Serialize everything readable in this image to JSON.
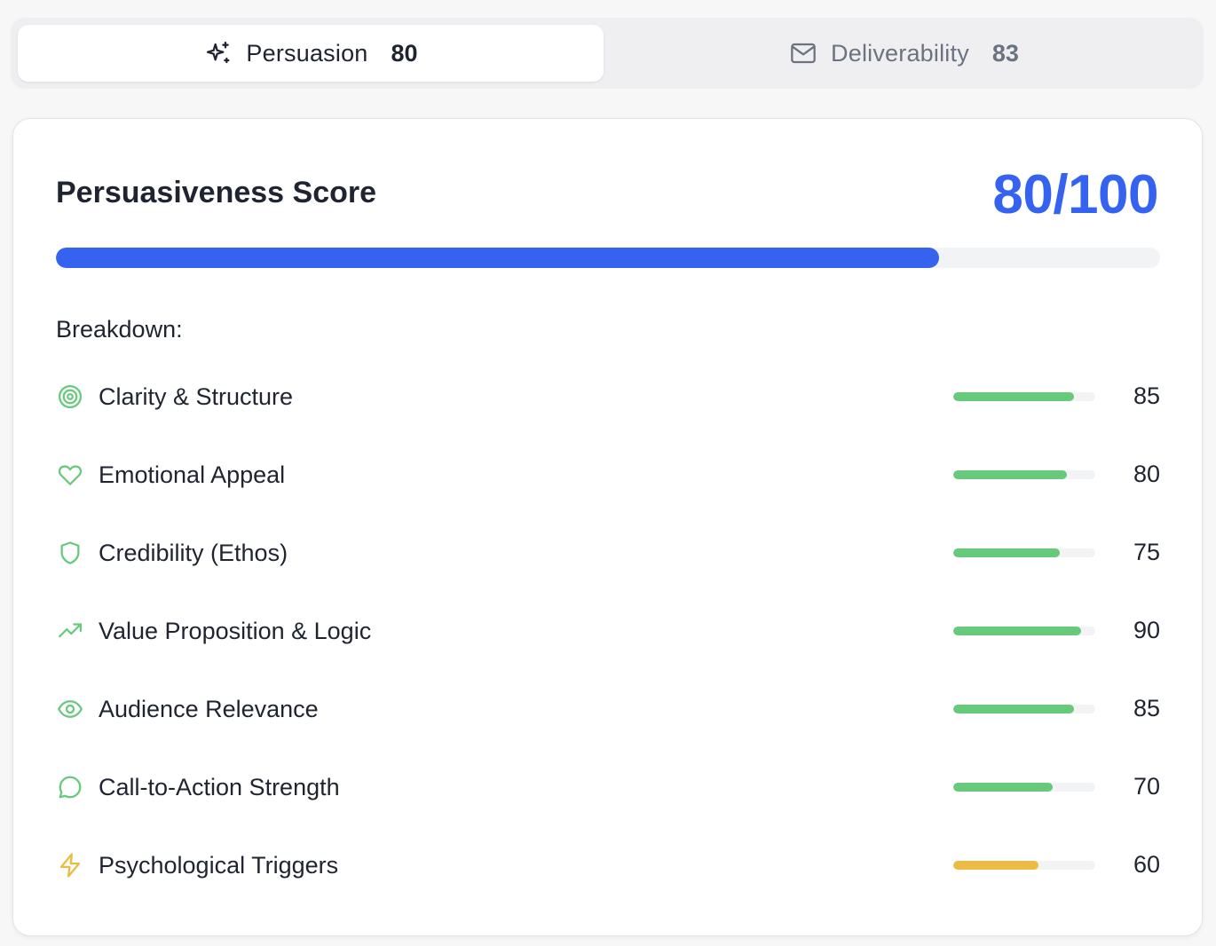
{
  "tabs": [
    {
      "label": "Persuasion",
      "score": "80",
      "icon": "sparkles-icon",
      "active": true
    },
    {
      "label": "Deliverability",
      "score": "83",
      "icon": "mail-icon",
      "active": false
    }
  ],
  "card": {
    "title": "Persuasiveness Score",
    "score_text": "80/100",
    "score": 80,
    "max": 100,
    "breakdown_label": "Breakdown:"
  },
  "colors": {
    "accent": "#3563f0",
    "good": "#66c97b",
    "warn": "#ebbb44",
    "track": "#f2f3f5"
  },
  "breakdown": [
    {
      "label": "Clarity & Structure",
      "value": 85,
      "value_text": "85",
      "icon": "target-icon",
      "color": "#66c97b"
    },
    {
      "label": "Emotional Appeal",
      "value": 80,
      "value_text": "80",
      "icon": "heart-icon",
      "color": "#66c97b"
    },
    {
      "label": "Credibility (Ethos)",
      "value": 75,
      "value_text": "75",
      "icon": "shield-icon",
      "color": "#66c97b"
    },
    {
      "label": "Value Proposition & Logic",
      "value": 90,
      "value_text": "90",
      "icon": "trending-up-icon",
      "color": "#66c97b"
    },
    {
      "label": "Audience Relevance",
      "value": 85,
      "value_text": "85",
      "icon": "eye-icon",
      "color": "#66c97b"
    },
    {
      "label": "Call-to-Action Strength",
      "value": 70,
      "value_text": "70",
      "icon": "message-circle-icon",
      "color": "#66c97b"
    },
    {
      "label": "Psychological Triggers",
      "value": 60,
      "value_text": "60",
      "icon": "zap-icon",
      "color": "#ebbb44"
    }
  ]
}
